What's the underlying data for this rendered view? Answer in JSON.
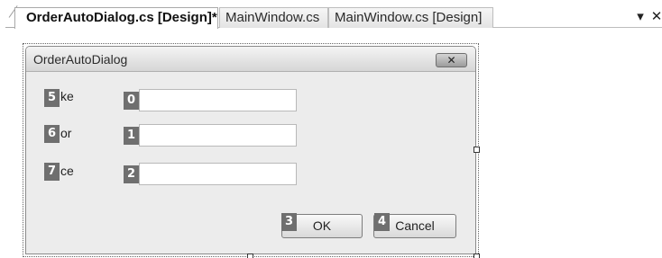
{
  "tabs": [
    {
      "label": "OrderAutoDialog.cs [Design]*",
      "active": true
    },
    {
      "label": "MainWindow.cs",
      "active": false
    },
    {
      "label": "MainWindow.cs [Design]",
      "active": false
    }
  ],
  "tabstrip": {
    "dropdown_glyph": "▾",
    "close_glyph": "✕"
  },
  "form": {
    "title": "OrderAutoDialog",
    "close_glyph": "✕",
    "labels": [
      "ke",
      "or",
      "ce"
    ],
    "label_badges": [
      "5",
      "6",
      "7"
    ],
    "textbox_badges": [
      "0",
      "1",
      "2"
    ],
    "textbox_values": [
      "",
      "",
      ""
    ],
    "ok_badge": "3",
    "ok_label": "OK",
    "cancel_badge": "4",
    "cancel_label": "Cancel"
  }
}
